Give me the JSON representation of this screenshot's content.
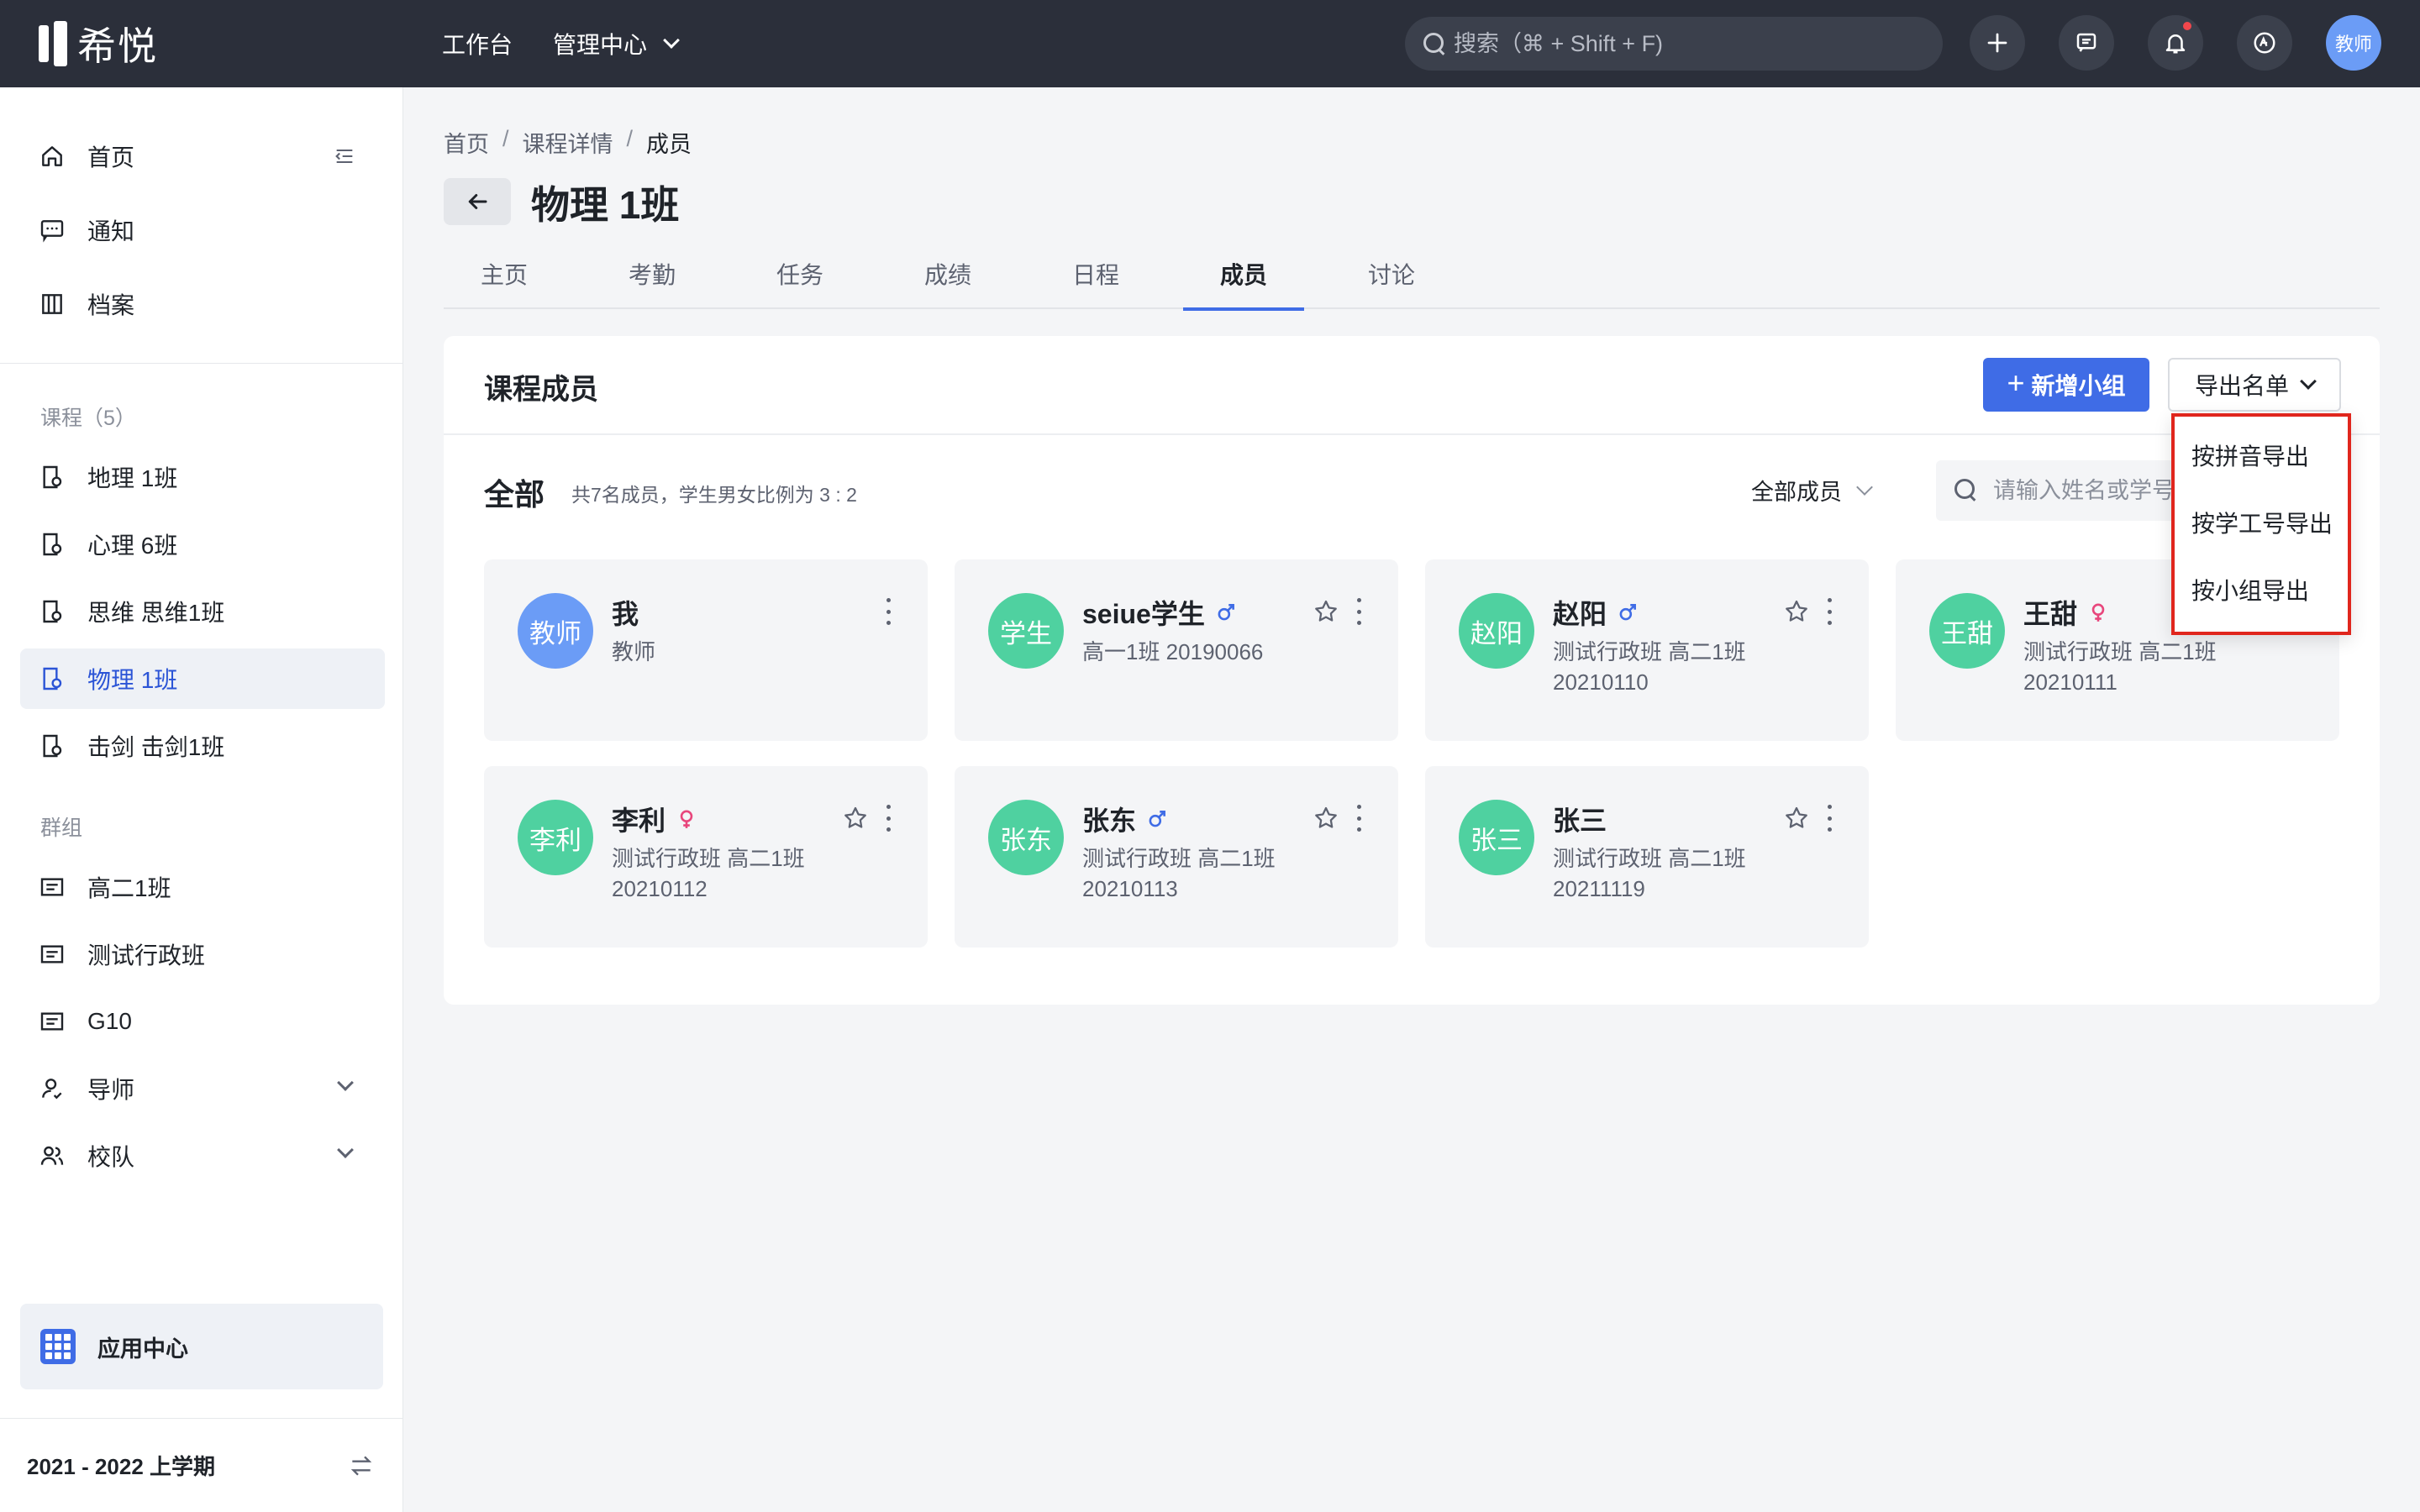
{
  "app": {
    "logo_text": "希悦"
  },
  "topnav": {
    "workbench": "工作台",
    "admin_center": "管理中心"
  },
  "search": {
    "placeholder": "搜索（⌘ + Shift + F)"
  },
  "topbar": {
    "user_avatar": "教师"
  },
  "sidebar": {
    "main_items": [
      {
        "label": "首页",
        "icon": "home-icon"
      },
      {
        "label": "通知",
        "icon": "message-icon"
      },
      {
        "label": "档案",
        "icon": "archive-icon"
      }
    ],
    "courses_heading": "课程（5）",
    "courses": [
      {
        "label": "地理 1班"
      },
      {
        "label": "心理 6班"
      },
      {
        "label": "思维 思维1班"
      },
      {
        "label": "物理 1班",
        "active": true
      },
      {
        "label": "击剑 击剑1班"
      }
    ],
    "groups_heading": "群组",
    "groups": [
      {
        "label": "高二1班"
      },
      {
        "label": "测试行政班"
      },
      {
        "label": "G10"
      },
      {
        "label": "导师"
      },
      {
        "label": "校队"
      }
    ],
    "app_center": "应用中心",
    "term": "2021 - 2022 上学期"
  },
  "breadcrumb": {
    "home": "首页",
    "course_detail": "课程详情",
    "current": "成员",
    "separator": "/"
  },
  "page": {
    "title": "物理 1班"
  },
  "tabs": [
    {
      "label": "主页"
    },
    {
      "label": "考勤"
    },
    {
      "label": "任务"
    },
    {
      "label": "成绩"
    },
    {
      "label": "日程"
    },
    {
      "label": "成员",
      "active": true
    },
    {
      "label": "讨论"
    }
  ],
  "panel": {
    "title": "课程成员",
    "add_group": "新增小组",
    "add_group_icon": "+",
    "export": "导出名单",
    "filter_title": "全部",
    "filter_count": "共7名成员，学生男女比例为 3 : 2",
    "member_filter": "全部成员",
    "member_search_placeholder": "请输入姓名或学号"
  },
  "export_menu": [
    "按拼音导出",
    "按学工号导出",
    "按小组导出"
  ],
  "members": [
    {
      "avatar": "教师",
      "name": "我",
      "gender": "",
      "line1": "教师",
      "line2": "",
      "role": "teacher"
    },
    {
      "avatar": "学生",
      "name": "seiue学生",
      "gender": "male",
      "line1": "高一1班 20190066",
      "line2": ""
    },
    {
      "avatar": "赵阳",
      "name": "赵阳",
      "gender": "male",
      "line1": "测试行政班 高二1班",
      "line2": "20210110"
    },
    {
      "avatar": "王甜",
      "name": "王甜",
      "gender": "female",
      "line1": "测试行政班 高二1班",
      "line2": "20210111"
    },
    {
      "avatar": "李利",
      "name": "李利",
      "gender": "female",
      "line1": "测试行政班 高二1班",
      "line2": "20210112"
    },
    {
      "avatar": "张东",
      "name": "张东",
      "gender": "male",
      "line1": "测试行政班 高二1班",
      "line2": "20210113"
    },
    {
      "avatar": "张三",
      "name": "张三",
      "gender": "",
      "line1": "测试行政班 高二1班",
      "line2": "20211119"
    }
  ],
  "colors": {
    "accent": "#3f6ce6",
    "student_avatar": "#4fd1a0",
    "teacher_avatar": "#6b9cf6",
    "male": "#3f6ce6",
    "female": "#e8467c",
    "highlight_border": "#e0261d"
  }
}
